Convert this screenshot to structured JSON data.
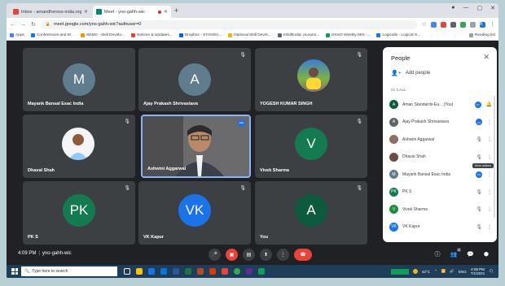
{
  "browser": {
    "tabs": [
      {
        "title": "Inbox - amandheress-india.org -",
        "active": false
      },
      {
        "title": "Meet - yno-gahh-wic",
        "active": true
      }
    ],
    "url": "meet.google.com/yno-gahh-wic?authuser=0",
    "bookmarks": [
      "Apps",
      "Conferences and M...",
      "SDMS - Skill Develo...",
      "Notices & Updates...",
      "Dropbox - STANDA...",
      "National Skill Devel...",
      "eSkillIndia: eLearni...",
      "DSSO Weekly MIS -...",
      "Logicalis - Logical S..."
    ],
    "reading_list": "Reading list",
    "profile_initial": "A"
  },
  "meet": {
    "tiles": [
      {
        "name": "Mayank Bansal Esac India",
        "initial": "M",
        "color": "#5f7d8c"
      },
      {
        "name": "Ajay Prakash Shrivastava",
        "initial": "A",
        "color": "#5f7d8c"
      },
      {
        "name": "YOGESH KUMAR SINGH",
        "initial": "",
        "color": ""
      },
      {
        "name": "Dhaval Shah",
        "initial": "",
        "color": ""
      },
      {
        "name": "Ashwini Aggarwal",
        "initial": "",
        "color": ""
      },
      {
        "name": "Vivek Sharma",
        "initial": "V",
        "color": "#137b4f"
      },
      {
        "name": "PK S",
        "initial": "PK",
        "color": "#137b4f"
      },
      {
        "name": "VK Kapur",
        "initial": "VK",
        "color": "#1a73e8"
      },
      {
        "name": "You",
        "initial": "A",
        "color": "#0d5b3f"
      }
    ],
    "meeting_time": "4:09 PM",
    "meeting_code": "yno-gahh-wic",
    "participant_count": "6"
  },
  "people_panel": {
    "title": "People",
    "add_people": "Add people",
    "in_call_label": "IN CALL",
    "tooltip": "More actions",
    "participants": [
      {
        "name": "Aman Standards-Ea... (You)",
        "initial": "A",
        "color": "#0d5b3f"
      },
      {
        "name": "Ajay Prakash Shrivastava",
        "initial": "A",
        "color": "#5f6368"
      },
      {
        "name": "Ashwini Aggarwal",
        "initial": "",
        "color": "#8d6e63"
      },
      {
        "name": "Dhaval Shah",
        "initial": "",
        "color": "#6d4c41"
      },
      {
        "name": "Mayank Bansal Esac India",
        "initial": "M",
        "color": "#5f7d8c"
      },
      {
        "name": "PK S",
        "initial": "PK",
        "color": "#137b4f"
      },
      {
        "name": "Vivek Sharma",
        "initial": "V",
        "color": "#1e8e3e"
      },
      {
        "name": "VK Kapur",
        "initial": "VK",
        "color": "#1a73e8"
      }
    ]
  },
  "taskbar": {
    "search_placeholder": "Type here to search",
    "temperature": "42°C",
    "language": "ENG",
    "time": "4:09 PM",
    "date": "7/1/2021"
  }
}
